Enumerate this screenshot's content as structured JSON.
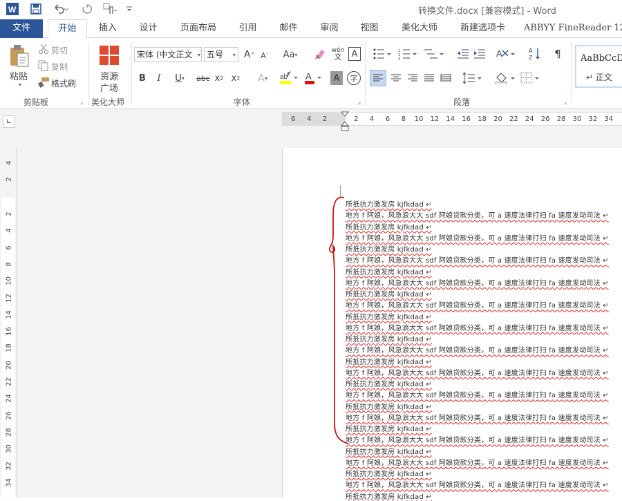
{
  "window": {
    "title": "转换文件.docx [兼容模式] - Word"
  },
  "quick_access": {
    "word_logo": "W",
    "save_icon": "save-icon",
    "undo_icon": "undo-icon",
    "redo_icon": "redo-icon",
    "touch_icon": "touch-mode-icon",
    "customize_icon": "customize-icon"
  },
  "tabs": {
    "file": "文件",
    "home": "开始",
    "insert": "插入",
    "design": "设计",
    "layout": "页面布局",
    "references": "引用",
    "mailings": "邮件",
    "review": "审阅",
    "view": "视图",
    "beautify": "美化大师",
    "new_tab": "新建选项卡",
    "abbyy": "ABBYY FineReader 12"
  },
  "ribbon": {
    "clipboard": {
      "paste": "粘贴",
      "cut": "剪切",
      "copy": "复制",
      "format_painter": "格式刷",
      "group_label": "剪贴板"
    },
    "beautify": {
      "resource_line1": "资源",
      "resource_line2": "广场",
      "group_label": "美化大师"
    },
    "font": {
      "font_name": "宋体 (中文正文",
      "font_size": "五号",
      "group_label": "字体",
      "grow": "A",
      "shrink": "A",
      "case": "Aa",
      "phonetic": "wén",
      "bold": "B",
      "italic": "I",
      "underline": "U",
      "strike": "abc",
      "sub": "x",
      "sup": "x"
    },
    "paragraph": {
      "group_label": "段落"
    },
    "styles": {
      "sample": "AaBbCcD",
      "normal": "正文"
    }
  },
  "ruler": {
    "h_left": [
      "6",
      "4",
      "2"
    ],
    "h_right": [
      "2",
      "4",
      "6",
      "8",
      "10",
      "12",
      "14",
      "16",
      "18",
      "20",
      "22",
      "24",
      "26",
      "28",
      "30",
      "32",
      "34"
    ],
    "v_top": [
      "4",
      "2"
    ],
    "v_main": [
      "2",
      "4",
      "6",
      "8",
      "10",
      "12",
      "14",
      "16",
      "18",
      "20",
      "22",
      "24",
      "26",
      "28",
      "30",
      "32",
      "34"
    ]
  },
  "document": {
    "lines": [
      "所抵抗力激发房 kjfkdad",
      "地方 f 阿娘，风急浪大大 sdf 阿娘贷款分类，可 a 速度法律打扫 fa 速度发动司法",
      "所抵抗力激发房 kjfkdad",
      "地方 f 阿娘，风急浪大大 sdf 阿娘贷款分类，可 a 速度法律打扫 fa 速度发动司法",
      "所抵抗力激发房 kjfkdad",
      "地方 f 阿娘，风急浪大大 sdf 阿娘贷款分类，可 a 速度法律打扫 fa 速度发动司法",
      "所抵抗力激发房 kjfkdad",
      "地方 f 阿娘，风急浪大大 sdf 阿娘贷款分类，可 a 速度法律打扫 fa 速度发动司法",
      "所抵抗力激发房 kjfkdad",
      "地方 f 阿娘，风急浪大大 sdf 阿娘贷款分类，可 a 速度法律打扫 fa 速度发动司法",
      "所抵抗力激发房 kjfkdad",
      "地方 f 阿娘，风急浪大大 sdf 阿娘贷款分类，可 a 速度法律打扫 fa 速度发动司法",
      "所抵抗力激发房 kjfkdad",
      "地方 f 阿娘，风急浪大大 sdf 阿娘贷款分类，可 a 速度法律打扫 fa 速度发动司法",
      "所抵抗力激发房 kjfkdad",
      "地方 f 阿娘，风急浪大大 sdf 阿娘贷款分类，可 a 速度法律打扫 fa 速度发动司法",
      "所抵抗力激发房 kjfkdad",
      "地方 f 阿娘，风急浪大大 sdf 阿娘贷款分类，可 a 速度法律打扫 fa 速度发动司法",
      "所抵抗力激发房 kjfkdad",
      "地方 f 阿娘，风急浪大大 sdf 阿娘贷款分类，可 a 速度法律打扫 fa 速度发动司法",
      "所抵抗力激发房 kjfkdad",
      "地方 f 阿娘，风急浪大大 sdf 阿娘贷款分类，可 a 速度法律打扫 fa 速度发动司法",
      "所抵抗力激发房 kjfkdad",
      "地方 f 阿娘，风急浪大大 sdf 阿娘贷款分类，可 a 速度法律打扫 fa 速度发动司法",
      "所抵抗力激发房 kjfkdad",
      "地方 f 阿娘，风急浪大大 sdf 阿娘贷款分类，可 a 速度法律打扫 fa 速度发动司法",
      "所抵抗力激发房 kjfkdad"
    ]
  },
  "colors": {
    "accent": "#2b579a",
    "annotation": "#cc1111",
    "spell": "#dd2222"
  }
}
